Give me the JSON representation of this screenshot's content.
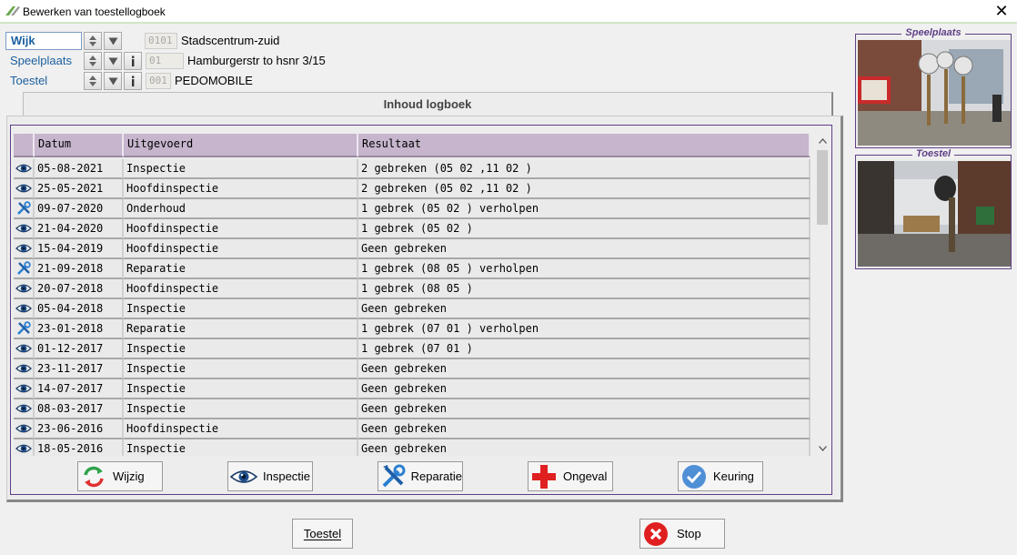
{
  "window": {
    "title": "Bewerken van toestellogboek",
    "close_label": "✕"
  },
  "selectors": [
    {
      "label": "Wijk",
      "code": "0101",
      "value": "Stadscentrum-zuid",
      "has_info": false,
      "active": true
    },
    {
      "label": "Speelplaats",
      "code": "01",
      "value": "Hamburgerstr to hsnr 3/15",
      "has_info": true,
      "active": false
    },
    {
      "label": "Toestel",
      "code": "001",
      "value": "PEDOMOBILE",
      "has_info": true,
      "active": false
    }
  ],
  "tab": {
    "label": "Inhoud logboek"
  },
  "grid": {
    "columns": [
      "",
      "Datum",
      "Uitgevoerd",
      "Resultaat"
    ],
    "rows": [
      {
        "icon": "eye-icon",
        "date": "05-08-2021",
        "done": "Inspectie",
        "result": "2 gebreken (05 02 ,11 02 )"
      },
      {
        "icon": "eye-icon",
        "date": "25-05-2021",
        "done": "Hoofdinspectie",
        "result": "2 gebreken (05 02 ,11 02 )"
      },
      {
        "icon": "tools-icon",
        "date": "09-07-2020",
        "done": "Onderhoud",
        "result": "1 gebrek (05 02 ) verholpen"
      },
      {
        "icon": "eye-icon",
        "date": "21-04-2020",
        "done": "Hoofdinspectie",
        "result": "1 gebrek (05 02 )"
      },
      {
        "icon": "eye-icon",
        "date": "15-04-2019",
        "done": "Hoofdinspectie",
        "result": "Geen gebreken"
      },
      {
        "icon": "tools-icon",
        "date": "21-09-2018",
        "done": "Reparatie",
        "result": "1 gebrek (08 05 ) verholpen"
      },
      {
        "icon": "eye-icon",
        "date": "20-07-2018",
        "done": "Hoofdinspectie",
        "result": "1 gebrek (08 05 )"
      },
      {
        "icon": "eye-icon",
        "date": "05-04-2018",
        "done": "Inspectie",
        "result": "Geen gebreken"
      },
      {
        "icon": "tools-icon",
        "date": "23-01-2018",
        "done": "Reparatie",
        "result": "1 gebrek (07 01 ) verholpen"
      },
      {
        "icon": "eye-icon",
        "date": "01-12-2017",
        "done": "Inspectie",
        "result": "1 gebrek (07 01 )"
      },
      {
        "icon": "eye-icon",
        "date": "23-11-2017",
        "done": "Inspectie",
        "result": "Geen gebreken"
      },
      {
        "icon": "eye-icon",
        "date": "14-07-2017",
        "done": "Inspectie",
        "result": "Geen gebreken"
      },
      {
        "icon": "eye-icon",
        "date": "08-03-2017",
        "done": "Inspectie",
        "result": "Geen gebreken"
      },
      {
        "icon": "eye-icon",
        "date": "23-06-2016",
        "done": "Hoofdinspectie",
        "result": "Geen gebreken"
      },
      {
        "icon": "eye-icon",
        "date": "18-05-2016",
        "done": "Inspectie",
        "result": "Geen gebreken"
      }
    ]
  },
  "actions": [
    {
      "id": "wijzig",
      "label": "Wijzig",
      "icon": "refresh-icon"
    },
    {
      "id": "inspectie",
      "label": "Inspectie",
      "icon": "eye-icon"
    },
    {
      "id": "reparatie",
      "label": "Reparatie",
      "icon": "tools-icon"
    },
    {
      "id": "ongeval",
      "label": "Ongeval",
      "icon": "red-cross-icon"
    },
    {
      "id": "keuring",
      "label": "Keuring",
      "icon": "check-circle-icon"
    }
  ],
  "photos": {
    "speelplaats": {
      "caption": "Speelplaats"
    },
    "toestel": {
      "caption": "Toestel"
    }
  },
  "footer": {
    "toestel_label": "Toestel",
    "stop_label": "Stop"
  },
  "colors": {
    "accent": "#5f3f86",
    "header": "#c6b5cc",
    "link": "#1b5f9e"
  }
}
